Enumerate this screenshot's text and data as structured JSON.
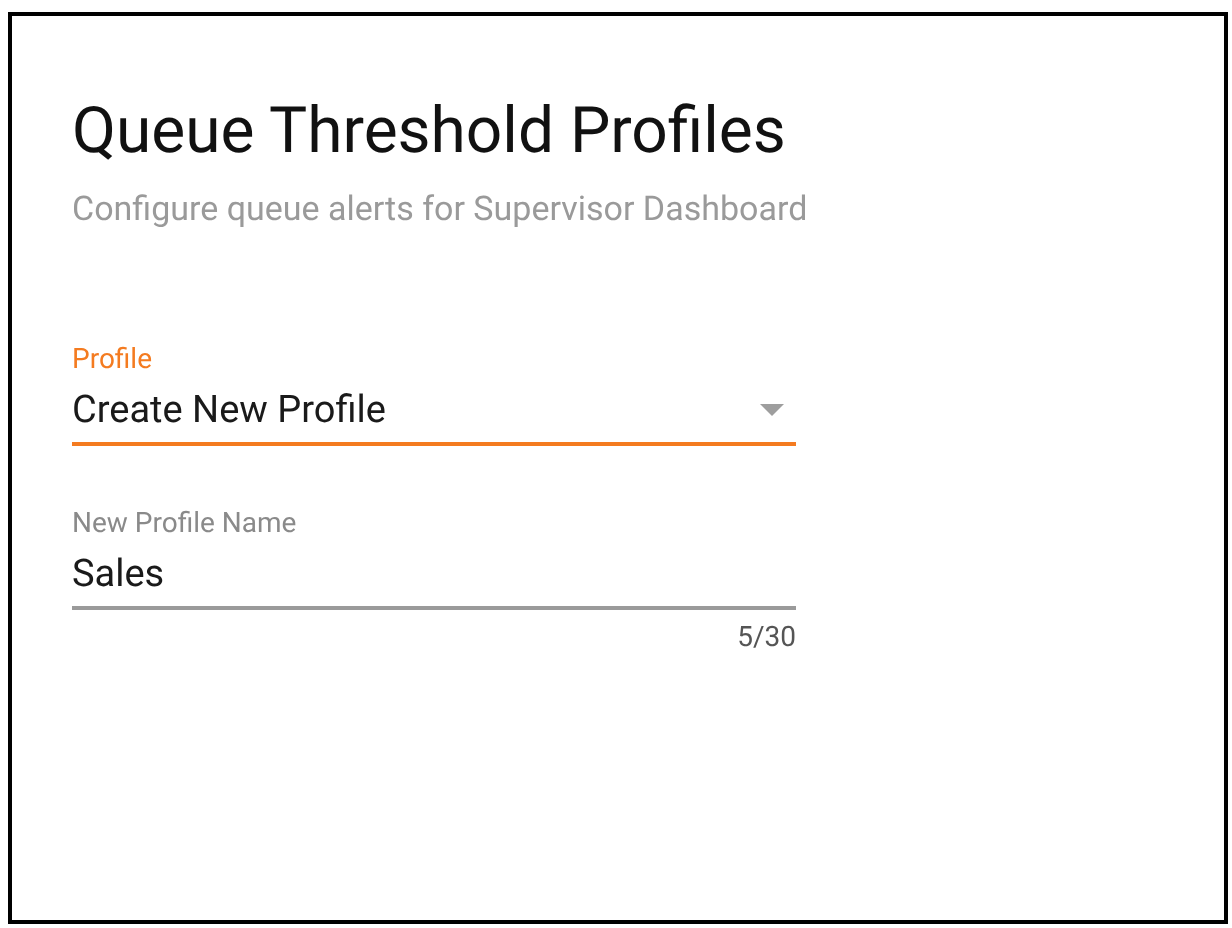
{
  "title": "Queue Threshold Profiles",
  "subtitle": "Configure queue alerts for Supervisor Dashboard",
  "fields": [
    {
      "kind": "select",
      "label": "Profile",
      "value": "Create New Profile",
      "focused": true
    },
    {
      "kind": "text",
      "label": "New Profile Name",
      "value": "Sales",
      "focused": false,
      "counter": "5/30"
    }
  ]
}
